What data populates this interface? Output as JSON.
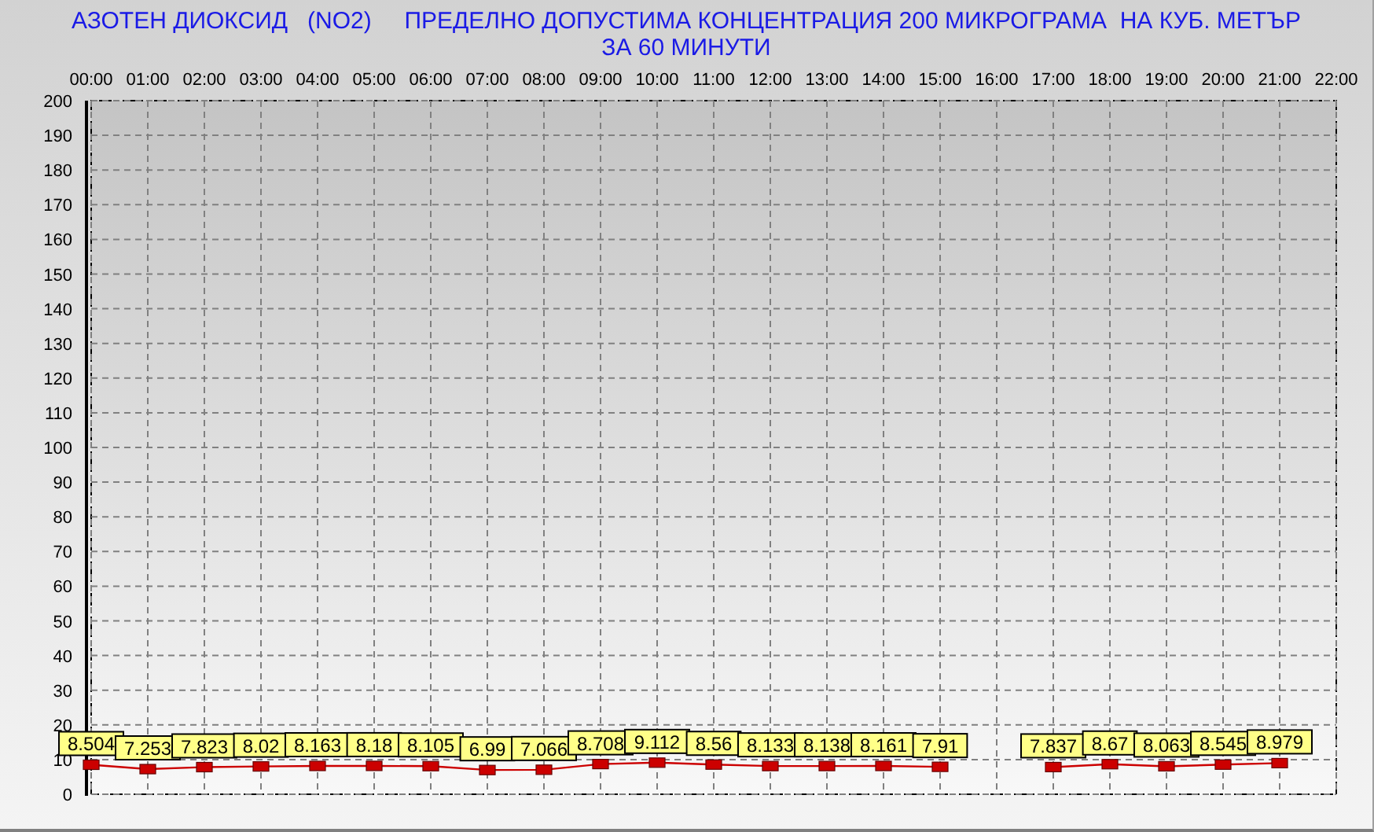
{
  "heading": {
    "lines": [
      "АЗОТЕН ДИОКСИД   (NO2)     ПРЕДЕЛНО ДОПУСТИМА КОНЦЕНТРАЦИЯ 200 МИКРОГРАМА  НА КУБ. МЕТЪР",
      "ЗА 60 МИНУТИ"
    ]
  },
  "chart_data": {
    "type": "line",
    "x": [
      0,
      1,
      2,
      3,
      4,
      5,
      6,
      7,
      8,
      9,
      10,
      11,
      12,
      13,
      14,
      15,
      16,
      17,
      18,
      19,
      20,
      21
    ],
    "grid": true,
    "series": [
      {
        "color": "#cc0000",
        "marker": "square",
        "values": [
          8.504,
          7.253,
          7.823,
          8.02,
          8.163,
          8.18,
          8.105,
          6.99,
          7.066,
          8.708,
          9.112,
          8.56,
          8.133,
          8.138,
          8.161,
          7.91,
          null,
          7.837,
          8.67,
          8.063,
          8.545,
          8.979
        ]
      }
    ],
    "value_labels": [
      "8.504",
      "7.253",
      "7.823",
      "8.02",
      "8.163",
      "8.18",
      "8.105",
      "6.99",
      "7.066",
      "8.708",
      "9.112",
      "8.56",
      "8.133",
      "8.138",
      "8.161",
      "7.91",
      null,
      "7.837",
      "8.67",
      "8.063",
      "8.545",
      "8.979"
    ],
    "xlim": [
      0,
      22
    ],
    "ylim": [
      0,
      200
    ],
    "xticks": [
      {
        "value": 0,
        "label": "00:00"
      },
      {
        "value": 1,
        "label": "01:00"
      },
      {
        "value": 2,
        "label": "02:00"
      },
      {
        "value": 3,
        "label": "03:00"
      },
      {
        "value": 4,
        "label": "04:00"
      },
      {
        "value": 5,
        "label": "05:00"
      },
      {
        "value": 6,
        "label": "06:00"
      },
      {
        "value": 7,
        "label": "07:00"
      },
      {
        "value": 8,
        "label": "08:00"
      },
      {
        "value": 9,
        "label": "09:00"
      },
      {
        "value": 10,
        "label": "10:00"
      },
      {
        "value": 11,
        "label": "11:00"
      },
      {
        "value": 12,
        "label": "12:00"
      },
      {
        "value": 13,
        "label": "13:00"
      },
      {
        "value": 14,
        "label": "14:00"
      },
      {
        "value": 15,
        "label": "15:00"
      },
      {
        "value": 16,
        "label": "16:00"
      },
      {
        "value": 17,
        "label": "17:00"
      },
      {
        "value": 18,
        "label": "18:00"
      },
      {
        "value": 19,
        "label": "19:00"
      },
      {
        "value": 20,
        "label": "20:00"
      },
      {
        "value": 21,
        "label": "21:00"
      },
      {
        "value": 22,
        "label": "22:00"
      }
    ],
    "yticks": [
      0,
      10,
      20,
      30,
      40,
      50,
      60,
      70,
      80,
      90,
      100,
      110,
      120,
      130,
      140,
      150,
      160,
      170,
      180,
      190,
      200
    ]
  }
}
